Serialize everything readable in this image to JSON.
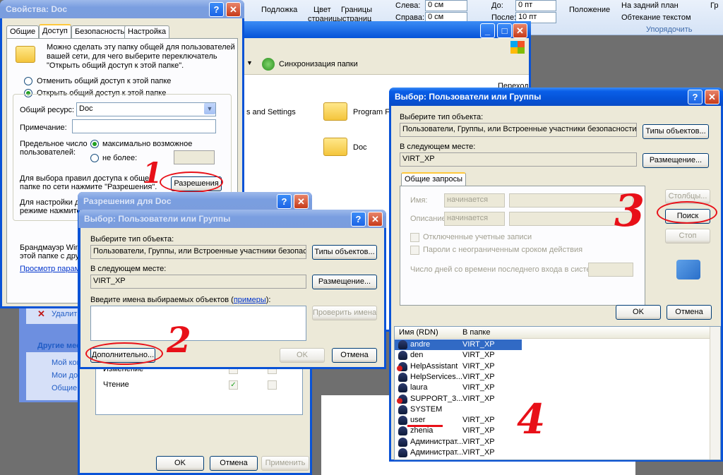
{
  "ribbon": {
    "group1": "Подложка",
    "group2a": "Цвет",
    "group2b": "страницы",
    "group3a": "Границы",
    "group3b": "страниц",
    "left_label": "Слева:",
    "left_value": "0 см",
    "right_label": "Справа:",
    "right_value": "0 см",
    "before_label": "До:",
    "before_value": "0 пт",
    "after_label": "После:",
    "after_value": "10 пт",
    "position": "Положение",
    "back_plan": "На задний план",
    "wrap_text": "Обтекание текстом",
    "arrange": "Упорядочить",
    "more": "Гр"
  },
  "explorer": {
    "sync_label": "Синхронизация папки",
    "item_settings": "s and Settings",
    "item_program": "Program Files",
    "item_doc": "Doc",
    "goto": "Переход"
  },
  "taskpane": {
    "delete": "Удалить",
    "other_places": "Другие места",
    "my_computer": "Мой компьютер",
    "my_docs": "Мои документы",
    "shared_docs": "Общие документы"
  },
  "props": {
    "title": "Свойства: Doc",
    "tabs": [
      "Общие",
      "Доступ",
      "Безопасность",
      "Настройка"
    ],
    "intro": [
      "Можно сделать эту папку общей для пользователей",
      "вашей сети, для чего выберите переключатель",
      "\"Открыть общий доступ к этой папке\"."
    ],
    "radio_off": "Отменить общий доступ к этой папке",
    "radio_on": "Открыть общий доступ к этой папке",
    "share_label": "Общий ресурс:",
    "share_value": "Doc",
    "note_label": "Примечание:",
    "limit_label1": "Предельное число",
    "limit_label2": "пользователей:",
    "max_possible": "максимально возможное",
    "no_more": "не более:",
    "rules1": "Для выбора правил доступа к общей",
    "rules2": "папке по сети нажмите \"Разрешения\".",
    "permissions_btn": "Разрешения",
    "offline1": "Для настройки до",
    "offline2": "режиме нажмите",
    "firewall1": "Брандмауэр Windo",
    "firewall2": "этой папке с друг",
    "firewall_link": "Просмотр парамет"
  },
  "perms": {
    "title": "Разрешения для Doc",
    "row_change": "Изменение",
    "row_read": "Чтение",
    "ok": "OK",
    "cancel": "Отмена",
    "apply": "Применить"
  },
  "select_small": {
    "title": "Выбор: Пользователи или Группы",
    "type_label": "Выберите тип объекта:",
    "type_value": "Пользователи, Группы, или Встроенные участники безопасност",
    "types_btn": "Типы объектов...",
    "loc_label": "В следующем месте:",
    "loc_value": "VIRT_XP",
    "loc_btn": "Размещение...",
    "names_label": "Введите имена выбираемых объектов (",
    "names_link": "примеры",
    "names_tail": "):",
    "check_btn": "Проверить имена",
    "advanced_btn": "Дополнительно...",
    "ok": "OK",
    "cancel": "Отмена"
  },
  "select_big": {
    "title": "Выбор: Пользователи или Группы",
    "type_label": "Выберите тип объекта:",
    "type_value": "Пользователи, Группы, или Встроенные участники безопасности",
    "types_btn": "Типы объектов...",
    "loc_label": "В следующем месте:",
    "loc_value": "VIRT_XP",
    "loc_btn": "Размещение...",
    "tab": "Общие запросы",
    "name_label": "Имя:",
    "name_mode": "начинается",
    "desc_label": "Описание:",
    "desc_mode": "начинается",
    "disabled_accounts": "Отключенные учетные записи",
    "no_expire": "Пароли с неограниченным сроком действия",
    "days_label": "Число дней со времени последнего входа в систему:",
    "columns_btn": "Столбцы...",
    "search_btn": "Поиск",
    "stop_btn": "Стоп",
    "ok": "OK",
    "cancel": "Отмена",
    "col_name": "Имя (RDN)",
    "col_folder": "В папке",
    "rows": [
      {
        "name": "andre",
        "folder": "VIRT_XP"
      },
      {
        "name": "den",
        "folder": "VIRT_XP"
      },
      {
        "name": "HelpAssistant",
        "folder": "VIRT_XP"
      },
      {
        "name": "HelpServices...",
        "folder": "VIRT_XP"
      },
      {
        "name": "laura",
        "folder": "VIRT_XP"
      },
      {
        "name": "SUPPORT_3...",
        "folder": "VIRT_XP"
      },
      {
        "name": "SYSTEM",
        "folder": ""
      },
      {
        "name": "user",
        "folder": "VIRT_XP"
      },
      {
        "name": "zhenia",
        "folder": "VIRT_XP"
      },
      {
        "name": "Администрат...",
        "folder": "VIRT_XP"
      },
      {
        "name": "Администрат...",
        "folder": "VIRT_XP"
      }
    ]
  },
  "annotations": [
    "1",
    "2",
    "3",
    "4"
  ],
  "colors": {
    "annotation": "#e81018",
    "xp_title": "#0a53d6",
    "dialog_bg": "#ece9d8"
  }
}
